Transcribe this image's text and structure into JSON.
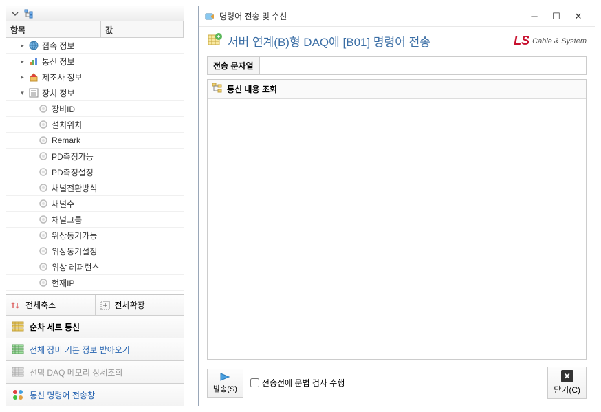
{
  "left": {
    "header": {
      "col1": "항목",
      "col2": "값"
    },
    "nodes": [
      {
        "label": "접속 정보",
        "icon": "globe",
        "indent": 1,
        "exp": "▸"
      },
      {
        "label": "통신 정보",
        "icon": "chart",
        "indent": 1,
        "exp": "▸"
      },
      {
        "label": "제조사 정보",
        "icon": "home",
        "indent": 1,
        "exp": "▸"
      },
      {
        "label": "장치 정보",
        "icon": "list",
        "indent": 1,
        "exp": "▾"
      },
      {
        "label": "장비ID",
        "icon": "bullet",
        "indent": 2,
        "exp": ""
      },
      {
        "label": "설치위치",
        "icon": "bullet",
        "indent": 2,
        "exp": ""
      },
      {
        "label": "Remark",
        "icon": "bullet",
        "indent": 2,
        "exp": ""
      },
      {
        "label": "PD측정가능",
        "icon": "bullet",
        "indent": 2,
        "exp": ""
      },
      {
        "label": "PD측정설정",
        "icon": "bullet",
        "indent": 2,
        "exp": ""
      },
      {
        "label": "채널전환방식",
        "icon": "bullet",
        "indent": 2,
        "exp": ""
      },
      {
        "label": "채널수",
        "icon": "bullet",
        "indent": 2,
        "exp": ""
      },
      {
        "label": "채널그룹",
        "icon": "bullet",
        "indent": 2,
        "exp": ""
      },
      {
        "label": "위상동기가능",
        "icon": "bullet",
        "indent": 2,
        "exp": ""
      },
      {
        "label": "위상동기설정",
        "icon": "bullet",
        "indent": 2,
        "exp": ""
      },
      {
        "label": "위상 레퍼런스",
        "icon": "bullet",
        "indent": 2,
        "exp": ""
      },
      {
        "label": "현재IP",
        "icon": "bullet",
        "indent": 2,
        "exp": ""
      }
    ],
    "bottom": {
      "collapse": "전체축소",
      "expand": "전체확장",
      "seq": "순차 세트 통신",
      "fetch": "전체 장비 기본 정보 받아오기",
      "daq": "선택 DAQ 메모리 상세조회",
      "cmdwin": "통신 명령어 전송창"
    }
  },
  "right": {
    "wintitle": "명령어 전송 및 수신",
    "header": "서버 연계(B)형 DAQ에 [B01] 명령어 전송",
    "logo_brand": "LS",
    "logo_sub": "Cable & System",
    "input_label": "전송 문자열",
    "input_value": "",
    "section_title": "통신 내용 조회",
    "send_label": "발송(S)",
    "check_label": "전송전에 문법 검사 수행",
    "close_label": "닫기(C)"
  }
}
